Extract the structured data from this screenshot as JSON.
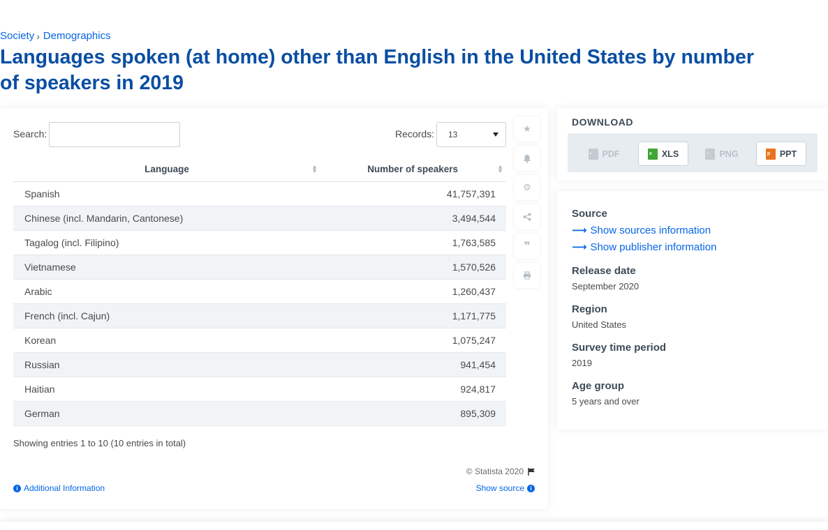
{
  "breadcrumb": {
    "items": [
      "Society",
      "Demographics"
    ],
    "separator": "›"
  },
  "title": "Languages spoken (at home) other than English in the United States by number of speakers in 2019",
  "controls": {
    "search_label": "Search:",
    "records_label": "Records:",
    "records_value": "13"
  },
  "table": {
    "headers": [
      "Language",
      "Number of speakers"
    ],
    "rows": [
      [
        "Spanish",
        "41,757,391"
      ],
      [
        "Chinese (incl. Mandarin, Cantonese)",
        "3,494,544"
      ],
      [
        "Tagalog (incl. Filipino)",
        "1,763,585"
      ],
      [
        "Vietnamese",
        "1,570,526"
      ],
      [
        "Arabic",
        "1,260,437"
      ],
      [
        "French (incl. Cajun)",
        "1,171,775"
      ],
      [
        "Korean",
        "1,075,247"
      ],
      [
        "Russian",
        "941,454"
      ],
      [
        "Haitian",
        "924,817"
      ],
      [
        "German",
        "895,309"
      ]
    ]
  },
  "footer": {
    "showing": "Showing entries 1 to 10 (10 entries in total)",
    "copyright": "© Statista 2020",
    "additional_info": "Additional Information",
    "show_source": "Show source"
  },
  "side_tools": [
    "star-icon",
    "bell-icon",
    "gear-icon",
    "share-icon",
    "quote-icon",
    "print-icon"
  ],
  "download": {
    "title": "DOWNLOAD",
    "buttons": [
      {
        "label": "PDF",
        "enabled": false
      },
      {
        "label": "XLS",
        "enabled": true
      },
      {
        "label": "PNG",
        "enabled": false
      },
      {
        "label": "PPT",
        "enabled": true
      }
    ]
  },
  "meta": {
    "source_heading": "Source",
    "show_sources": "Show sources information",
    "show_publisher": "Show publisher information",
    "release_heading": "Release date",
    "release_value": "September 2020",
    "region_heading": "Region",
    "region_value": "United States",
    "survey_heading": "Survey time period",
    "survey_value": "2019",
    "age_heading": "Age group",
    "age_value": "5 years and over"
  },
  "colors": {
    "link": "#0666e5",
    "title": "#0a4ea3",
    "xls": "#3fa535",
    "ppt": "#e8731f",
    "pdf": "#9aa3ab"
  }
}
